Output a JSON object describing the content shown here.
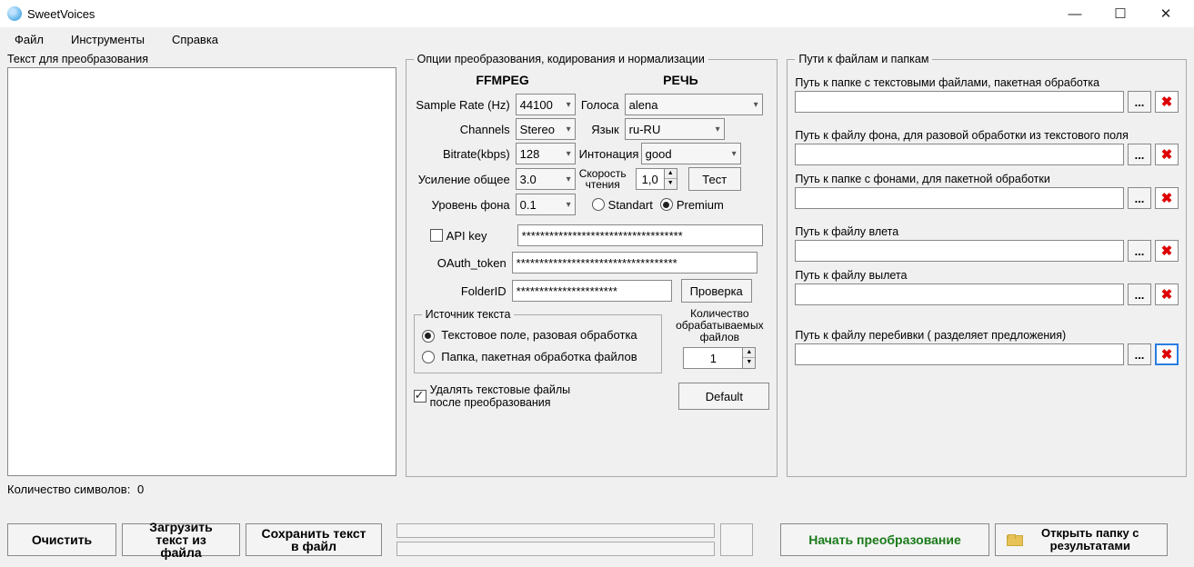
{
  "window": {
    "title": "SweetVoices"
  },
  "menu": {
    "file": "Файл",
    "tools": "Инструменты",
    "help": "Справка"
  },
  "left": {
    "label": "Текст для преобразования",
    "value": "",
    "charcount_label": "Количество символов:",
    "charcount": "0"
  },
  "mid": {
    "legend": "Опции преобразования, кодирования и нормализации",
    "ffmpeg": "FFMPEG",
    "speech": "РЕЧЬ",
    "sr_label": "Sample Rate (Hz)",
    "sr_val": "44100",
    "ch_label": "Channels",
    "ch_val": "Stereo",
    "br_label": "Bitrate(kbps)",
    "br_val": "128",
    "gain_label": "Усиление общее",
    "gain_val": "3.0",
    "bg_label": "Уровень фона",
    "bg_val": "0.1",
    "voice_label": "Голоса",
    "voice_val": "alena",
    "lang_label": "Язык",
    "lang_val": "ru-RU",
    "intone_label": "Интонация",
    "intone_val": "good",
    "speed_label": "Скорость чтения",
    "speed_val": "1,0",
    "test_btn": "Тест",
    "standart": "Standart",
    "premium": "Premium",
    "api_label": "API key",
    "api_val": "***********************************",
    "oauth_label": "OAuth_token",
    "oauth_val": "***********************************",
    "folder_label": "FolderID",
    "folder_val": "**********************",
    "check_btn": "Проверка",
    "src_legend": "Источник текста",
    "src1": "Текстовое поле, разовая обработка",
    "src2": "Папка, пакетная обработка файлов",
    "files_label": "Количество обрабатываемых файлов",
    "files_val": "1",
    "del_after": "Удалять текстовые файлы после преобразования",
    "default_btn": "Default"
  },
  "right": {
    "legend": "Пути к файлам и папкам",
    "p1": "Путь к папке с текстовыми файлами, пакетная обработка",
    "p2": "Путь к файлу фона, для разовой обработки из текстового поля",
    "p3": "Путь к папке с фонами, для пакетной обработки",
    "p4": "Путь к файлу влета",
    "p5": "Путь к файлу вылета",
    "p6": "Путь к файлу перебивки ( разделяет предложения)",
    "browse": "..."
  },
  "bottom": {
    "clear": "Очистить",
    "load": "Загрузить текст из файла",
    "save": "Сохранить текст в файл",
    "start": "Начать преобразование",
    "open": "Открыть папку с результатами"
  }
}
